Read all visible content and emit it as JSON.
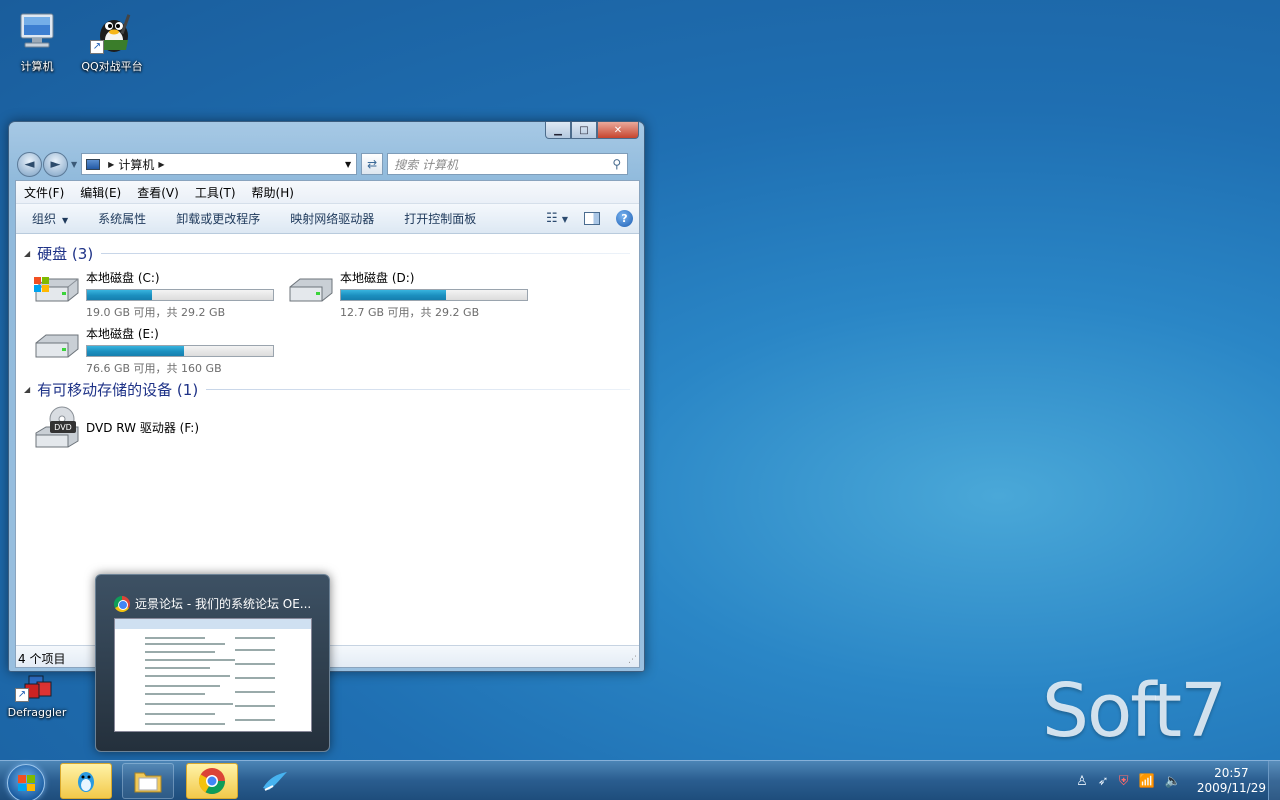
{
  "desktop": {
    "icons": [
      {
        "label": "计算机"
      },
      {
        "label": "QQ对战平台"
      },
      {
        "label": "Defraggler"
      }
    ],
    "watermark": "Soft7"
  },
  "window": {
    "caption_buttons": {
      "minimize": "▁",
      "maximize": "□",
      "close": "✕"
    },
    "address": {
      "path": "计算机"
    },
    "search": {
      "placeholder": "搜索 计算机"
    },
    "menu": [
      "文件(F)",
      "编辑(E)",
      "查看(V)",
      "工具(T)",
      "帮助(H)"
    ],
    "commands": [
      "组织",
      "系统属性",
      "卸载或更改程序",
      "映射网络驱动器",
      "打开控制面板"
    ],
    "groups": [
      {
        "title": "硬盘 (3)"
      },
      {
        "title": "有可移动存储的设备 (1)"
      }
    ],
    "drives": [
      {
        "name": "本地磁盘 (C:)",
        "space": "19.0 GB 可用，共 29.2 GB",
        "used_fraction": 0.35
      },
      {
        "name": "本地磁盘 (D:)",
        "space": "12.7 GB 可用，共 29.2 GB",
        "used_fraction": 0.565
      },
      {
        "name": "本地磁盘 (E:)",
        "space": "76.6 GB 可用，共 160 GB",
        "used_fraction": 0.52
      }
    ],
    "dvd": {
      "name": "DVD RW 驱动器 (F:)",
      "badge": "DVD"
    },
    "status": "4 个项目"
  },
  "thumbnail": {
    "title": "远景论坛 - 我们的系统论坛 OE..."
  },
  "taskbar": {
    "clock_time": "20:57",
    "clock_date": "2009/11/29"
  }
}
